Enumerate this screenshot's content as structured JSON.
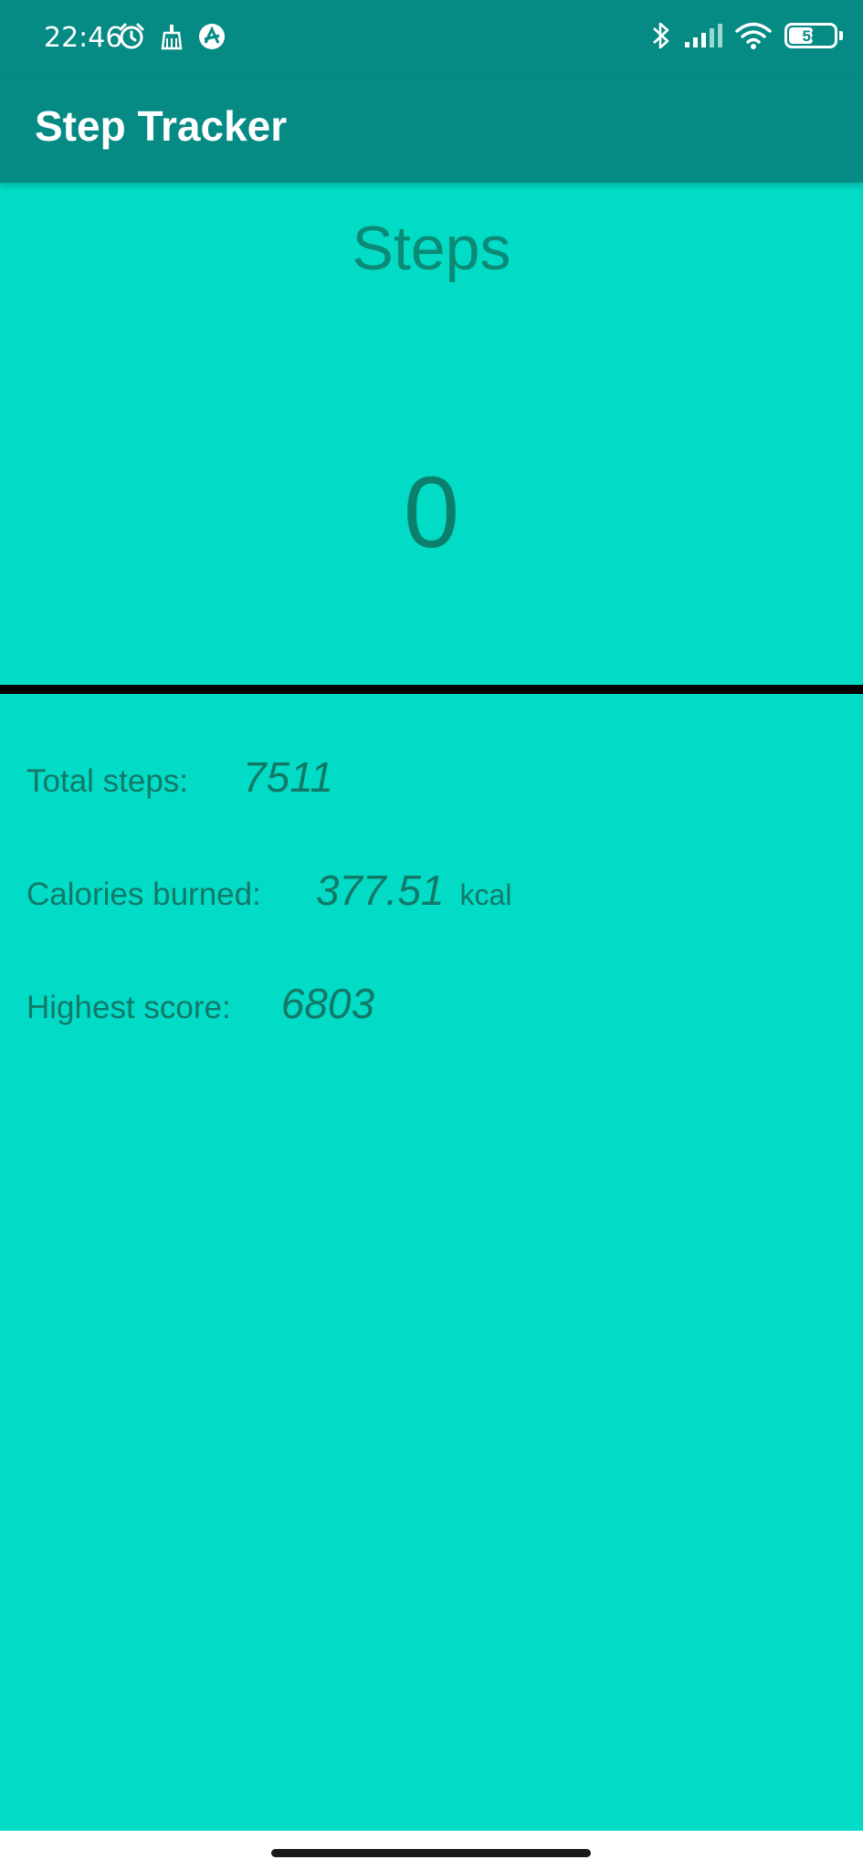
{
  "status_bar": {
    "time": "22:46",
    "left_icons": [
      "alarm-icon",
      "broom-icon",
      "notification-app-icon"
    ],
    "right_icons": [
      "bluetooth-icon",
      "signal-icon",
      "wifi-icon",
      "battery-icon"
    ],
    "battery_level": "58",
    "battery_fraction": 0.58
  },
  "app_bar": {
    "title": "Step Tracker"
  },
  "steps": {
    "heading": "Steps",
    "value": "0"
  },
  "stats": {
    "total_steps_label": "Total steps:",
    "total_steps_value": "7511",
    "calories_label": "Calories burned:",
    "calories_value": "377.51",
    "calories_unit": "kcal",
    "highest_score_label": "Highest score:",
    "highest_score_value": "6803"
  },
  "colors": {
    "app_bar": "#058a84",
    "background": "#02dcc6",
    "text_primary": "#0b8a75",
    "divider": "#000000"
  }
}
